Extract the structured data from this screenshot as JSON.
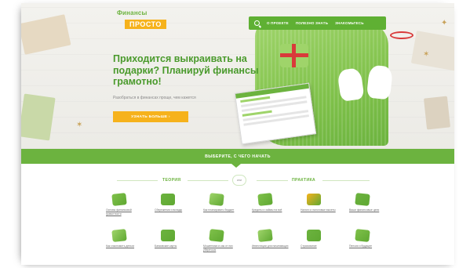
{
  "brand": {
    "line1": "Финансы",
    "line2": "ПРОСТО",
    "green": "#6cb33f",
    "yellow": "#f6b21c"
  },
  "nav": {
    "items": [
      "О ПРОЕКТЕ",
      "ПОЛЕЗНО ЗНАТЬ",
      "ЗНАКОМЬТЕСЬ"
    ]
  },
  "hero": {
    "headline": "Приходится выкраивать на подарки? Планируй финансы грамотно!",
    "sub": "Разобраться в финансах проще, чем кажется",
    "cta": "УЗНАТЬ БОЛЬШЕ ›"
  },
  "band": {
    "label": "ВЫБЕРИТЕ, С ЧЕГО НАЧАТЬ"
  },
  "sections": {
    "theory": "ТЕОРИЯ",
    "or": "или",
    "practice": "ПРАКТИКА"
  },
  "tiles": [
    {
      "caption": "Основы финансовой грамотности",
      "icon": "money-stack-icon",
      "color": "#7fc14a"
    },
    {
      "caption": "Сбережения и вклады",
      "icon": "piggy-bank-icon",
      "color": "#6cb33f"
    },
    {
      "caption": "Как планировать бюджет",
      "icon": "paper-plane-icon",
      "color": "#9fd46a"
    },
    {
      "caption": "Кредиты и займы на всё",
      "icon": "calculator-icon",
      "color": "#7fc14a"
    },
    {
      "caption": "Налоги и налоговые вычеты",
      "icon": "pencil-icon",
      "color": "#f6b21c"
    },
    {
      "caption": "Ваши финансовые цели",
      "icon": "hand-money-icon",
      "color": "#6cb33f"
    },
    {
      "caption": "Как сэкономить деньги",
      "icon": "house-icon",
      "color": "#9fd46a"
    },
    {
      "caption": "Банковские карты",
      "icon": "cards-icon",
      "color": "#6cb33f"
    },
    {
      "caption": "Мошенники и как от них уберечься",
      "icon": "lifebuoy-icon",
      "color": "#7fc14a"
    },
    {
      "caption": "Инвестиции для начинающих",
      "icon": "laptop-icon",
      "color": "#9fd46a"
    },
    {
      "caption": "Страхование",
      "icon": "umbrella-icon",
      "color": "#6cb33f"
    },
    {
      "caption": "Пенсия и будущее",
      "icon": "coins-icon",
      "color": "#7fc14a"
    }
  ]
}
